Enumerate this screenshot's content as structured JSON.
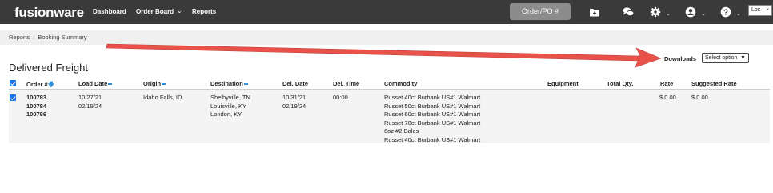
{
  "app": {
    "logo": "fusionware"
  },
  "nav": {
    "dashboard": "Dashboard",
    "order_board": "Order Board",
    "reports": "Reports"
  },
  "topbar": {
    "order_search_label": "Order/PO #",
    "units": "Lbs"
  },
  "breadcrumb": {
    "reports": "Reports",
    "separator": "/",
    "booking_summary": "Booking Summary"
  },
  "downloads": {
    "label": "Downloads",
    "select_value": "Select option"
  },
  "page": {
    "title": "Delivered Freight"
  },
  "table": {
    "headers": {
      "order": "Order #",
      "load_date": "Load Date",
      "origin": "Origin",
      "destination": "Destination",
      "del_date": "Del. Date",
      "del_time": "Del. Time",
      "commodity": "Commodity",
      "equipment": "Equipment",
      "total_qty": "Total Qty.",
      "rate": "Rate",
      "suggested_rate": "Suggested Rate"
    },
    "row": {
      "orders": [
        "100783",
        "100784",
        "100786"
      ],
      "load_dates": [
        "10/27/21",
        "02/19/24"
      ],
      "origin": "Idaho Falls, ID",
      "destinations": [
        "Shelbyville, TN",
        "Louisville, KY",
        "London, KY"
      ],
      "del_dates": [
        "10/31/21",
        "02/19/24"
      ],
      "del_time": "00:00",
      "commodities": [
        "Russet 40ct Burbank US#1 Walmart",
        "Russet 50ct Burbank US#1 Walmart",
        "Russet 60ct Burbank US#1 Walmart",
        "Russet 70ct Burbank US#1 Walmart",
        "6oz #2 Bales",
        "Russet 40ct Burbank US#1 Walmart"
      ],
      "rate": "$ 0.00",
      "suggested_rate": "$ 0.00"
    }
  },
  "colors": {
    "topbar": "#3a3a3a",
    "accent": "#1a73e8",
    "sort": "#2e8fd6",
    "annotation_arrow": "#e8524a"
  },
  "icons": [
    "add-document-icon",
    "chat-icon",
    "gear-icon",
    "user-icon",
    "help-icon",
    "chevron-down-icon",
    "sort-arrow-icon"
  ]
}
